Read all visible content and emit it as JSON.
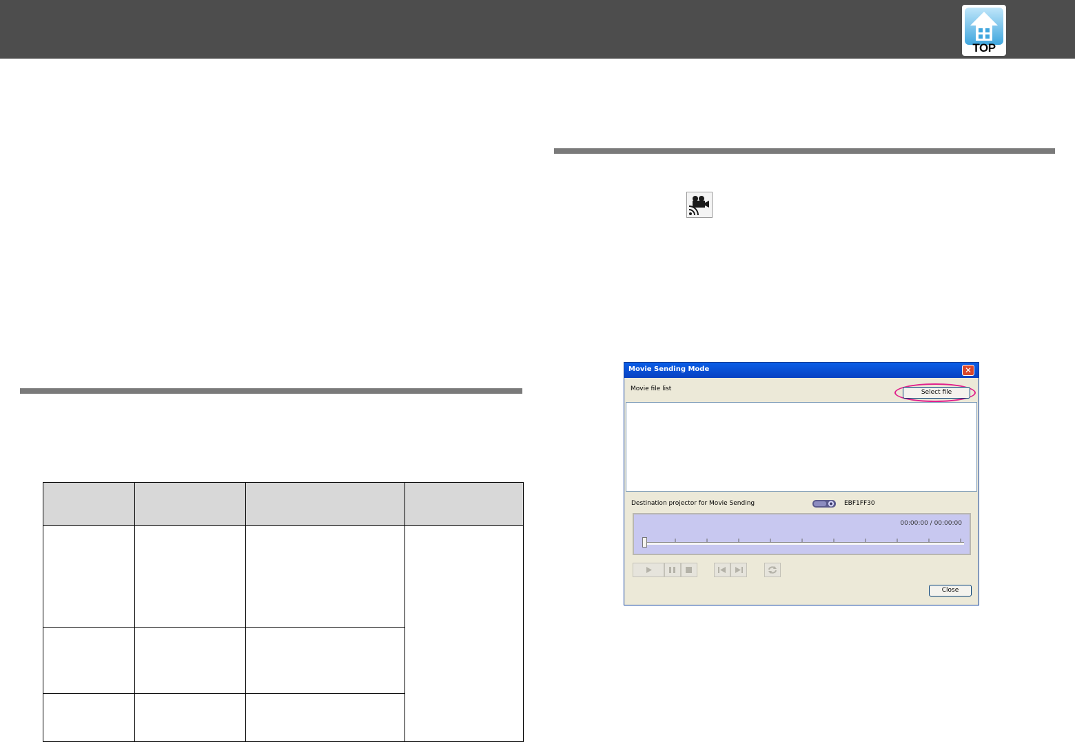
{
  "header": {
    "top_button_label": "TOP",
    "top_icon": "house-up-icon",
    "background": "#4d4d4d"
  },
  "page": {
    "movie_mode_icon": "movie-camera-wireless-icon"
  },
  "dialog": {
    "title": "Movie Sending Mode",
    "close_icon": "close-x-icon",
    "movie_file_list_label": "Movie file list",
    "select_file_button": "Select file",
    "destination_label": "Destination projector for Movie Sending",
    "projector_icon": "projector-icon",
    "projector_name": "EBF1FF30",
    "time_display": "00:00:00 / 00:00:00",
    "seek_position": 0,
    "controls": [
      "play-icon",
      "pause-icon",
      "stop-icon",
      "previous-icon",
      "next-icon",
      "repeat-icon"
    ],
    "close_button": "Close",
    "highlight_color": "#e0208c"
  },
  "table": {
    "columns": 4,
    "rows": 3
  }
}
